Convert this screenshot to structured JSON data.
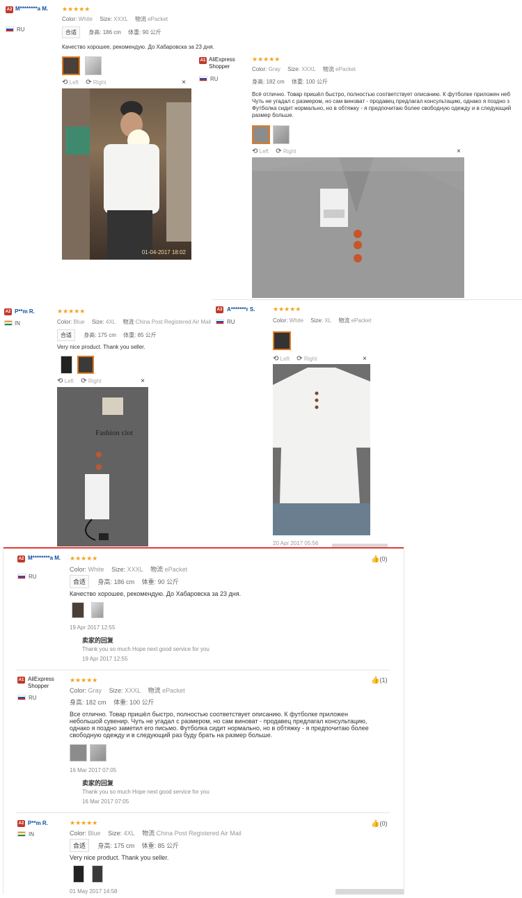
{
  "reviews_top": [
    {
      "badge": "A2",
      "name": "M********a M.",
      "country": "RU",
      "stars": "★★★★★",
      "color_label": "Color:",
      "color": "White",
      "size_label": "Size:",
      "size": "XXXL",
      "shipping_label": "物流",
      "shipping": "ePacket",
      "fit": "合适",
      "height_label": "身高:",
      "height": "186 cm",
      "weight_label": "体重:",
      "weight": "90 公斤",
      "text": "Качество хорошее, рекомендую. До Хабаровска за 23 дня.",
      "viewer": {
        "left": "Left",
        "right": "Right",
        "close": "×",
        "timestamp": "01-04-2017 18:02"
      }
    },
    {
      "badge": "A1",
      "name": "AliExpress Shopper",
      "country": "RU",
      "stars": "★★★★★",
      "color_label": "Color:",
      "color": "Gray",
      "size_label": "Size:",
      "size": "XXXL",
      "shipping_label": "物流",
      "shipping": "ePacket",
      "height_label": "身高:",
      "height": "182 cm",
      "weight_label": "体重:",
      "weight": "100 公斤",
      "text_lines": [
        "Всё отлично. Товар пришёл быстро, полностью соответствует описанию. К футболке приложен неб",
        "Чуть не угадал с размером, но сам виноват - продавец предлагал консультацию, однако я поздно з",
        "Футболка сидит нормально, но в обтяжку - я предпочитаю более свободную одежду и в следующий",
        "размер больше."
      ],
      "viewer": {
        "left": "Left",
        "right": "Right",
        "close": "×"
      }
    },
    {
      "badge": "A2",
      "name": "P**m R.",
      "country": "IN",
      "stars": "★★★★★",
      "color_label": "Color:",
      "color": "Blue",
      "size_label": "Size:",
      "size": "4XL",
      "shipping_label": "物流",
      "shipping": "China Post Registered Air Mail",
      "fit": "合适",
      "height_label": "身高:",
      "height": "175 cm",
      "weight_label": "体重:",
      "weight": "85 公斤",
      "text": "Very nice product. Thank you seller.",
      "viewer": {
        "left": "Left",
        "right": "Right",
        "close": "×",
        "package_text": "Fashion clot"
      }
    },
    {
      "badge": "A3",
      "name": "A*******r S.",
      "country": "RU",
      "stars": "★★★★★",
      "color_label": "Color:",
      "color": "White",
      "size_label": "Size:",
      "size": "XL",
      "shipping_label": "物流",
      "shipping": "ePacket",
      "viewer": {
        "left": "Left",
        "right": "Right",
        "close": "×",
        "timestamp": "20 Apr 2017 05:56"
      }
    }
  ],
  "reviews_list": [
    {
      "badge": "A2",
      "name": "M********a M.",
      "country": "RU",
      "stars": "★★★★★",
      "color_label": "Color:",
      "color": "White",
      "size_label": "Size:",
      "size": "XXXL",
      "shipping_label": "物流",
      "shipping": "ePacket",
      "fit": "合适",
      "height_label": "身高:",
      "height": "186 cm",
      "weight_label": "体重:",
      "weight": "90 公斤",
      "text": "Качество хорошее, рекомендую. До Хабаровска за 23 дня.",
      "date": "19 Apr 2017 12:55",
      "reply_title": "卖家的回复",
      "reply_text": "Thank you so much Hope next good service for you",
      "reply_date": "19 Apr 2017 12:55",
      "helpful": "(0)"
    },
    {
      "badge": "A1",
      "name": "AliExpress Shopper",
      "country": "RU",
      "stars": "★★★★★",
      "color_label": "Color:",
      "color": "Gray",
      "size_label": "Size:",
      "size": "XXXL",
      "shipping_label": "物流",
      "shipping": "ePacket",
      "height_label": "身高:",
      "height": "182 cm",
      "weight_label": "体重:",
      "weight": "100 公斤",
      "text_lines": [
        "Все отлично. Товар пришёл быстро, полностью соответствует описанию. К футболке приложен",
        "небольшой сувенир. Чуть не угадал с размером, но сам виноват - продавец предлагал консультацию,",
        "однако я поздно заметил его письмо. Футболка сидит нормально, но в обтяжку - я предпочитаю более",
        "свободную одежду и в следующий раз буду брать на размер больше."
      ],
      "date": "16 Mar 2017 07:05",
      "reply_title": "卖家的回复",
      "reply_text": "Thank you so much Hope next good service for you",
      "reply_date": "16 Mar 2017 07:05",
      "helpful": "(1)"
    },
    {
      "badge": "A2",
      "name": "P**m R.",
      "country": "IN",
      "stars": "★★★★★",
      "color_label": "Color:",
      "color": "Blue",
      "size_label": "Size:",
      "size": "4XL",
      "shipping_label": "物流",
      "shipping": "China Post Registered Air Mail",
      "fit": "合适",
      "height_label": "身高:",
      "height": "175 cm",
      "weight_label": "体重:",
      "weight": "85 公斤",
      "text": "Very nice product. Thank you seller.",
      "date": "01 May 2017 14:58",
      "helpful": "(0)"
    }
  ],
  "icons": {
    "rotate_left": "rotate-left-icon",
    "rotate_right": "rotate-right-icon",
    "thumbs_up": "thumbs-up-icon"
  },
  "colors": {
    "accent": "#e07b1f",
    "link": "#0b4ea2",
    "star": "#f2a31a",
    "divider_red": "#e53935",
    "badge": "#c0392b"
  }
}
